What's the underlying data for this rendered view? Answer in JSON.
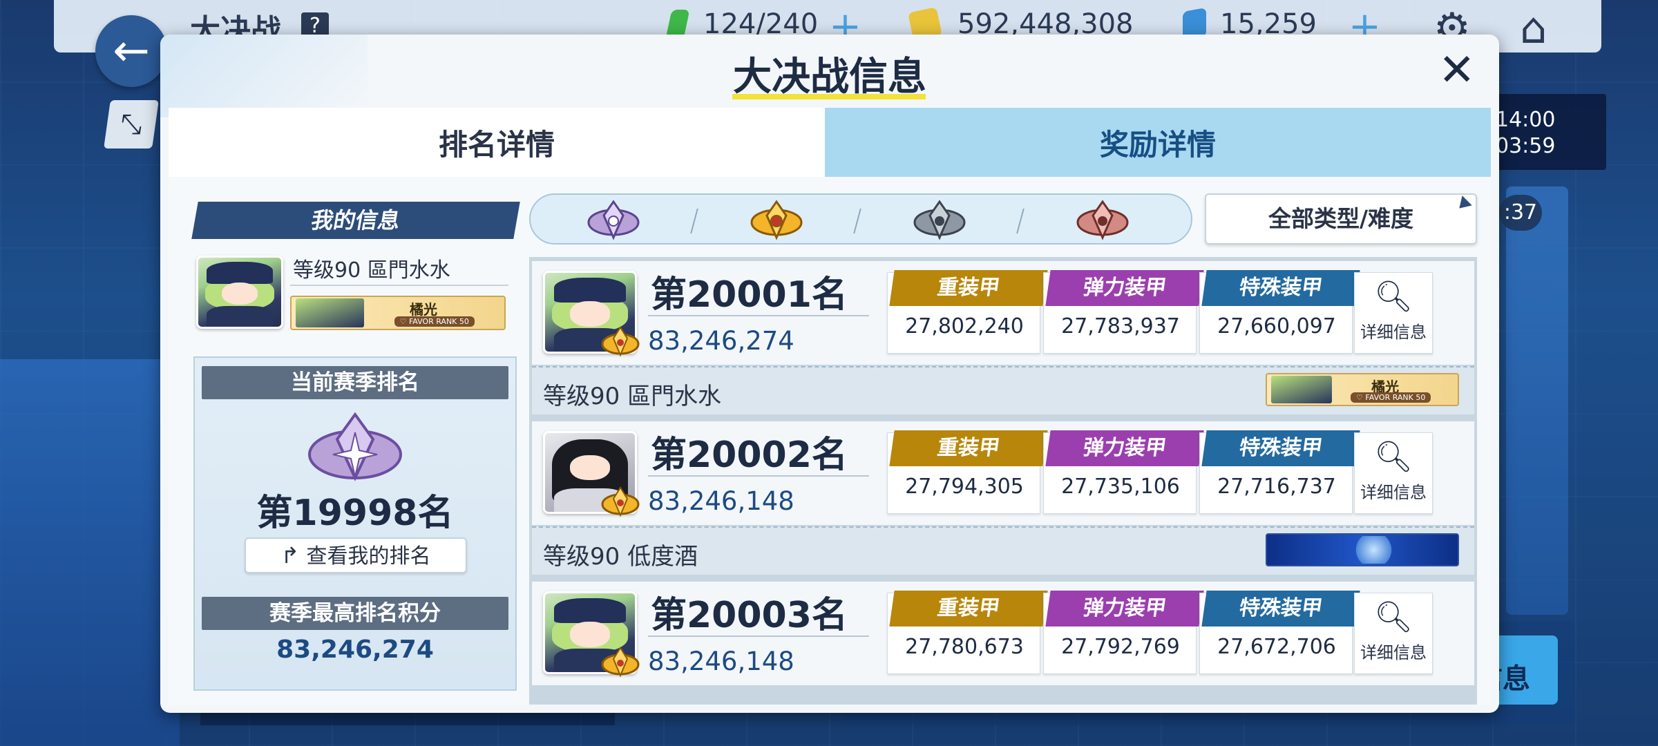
{
  "topbar": {
    "title": "大决战",
    "help_icon": "?",
    "energy": "124/240",
    "credits": "592,448,308",
    "gems": "15,259",
    "energy_color": "#3fb84a",
    "credits_color": "#e8c43a",
    "gems_color": "#3a8fd8"
  },
  "background": {
    "time_line1": "14:00",
    "time_line2": "03:59",
    "badge_text": ":37",
    "info_btn_text": "信息"
  },
  "modal": {
    "title": "大决战信息",
    "close_glyph": "✕",
    "tabs": [
      {
        "label": "排名详情",
        "active": true
      },
      {
        "label": "奖励详情",
        "active": false
      }
    ]
  },
  "my_info": {
    "header": "我的信息",
    "level_name": "等级90 區門水水",
    "namecard": {
      "name": "橘光",
      "rank": "♡ FAVOR RANK 50"
    },
    "season_rank_header": "当前赛季排名",
    "season_rank": "第19998名",
    "view_my_rank_label": "查看我的排名",
    "best_score_header": "赛季最高排名积分",
    "best_score": "83,246,274"
  },
  "filter": {
    "tiers": [
      "purple-tier",
      "gold-tier",
      "silver-tier",
      "bronze-tier"
    ],
    "difficulty_label": "全部类型/难度"
  },
  "armor_labels": {
    "heavy": "重装甲",
    "elastic": "弹力装甲",
    "special": "特殊装甲",
    "heavy_color": "#b8860b",
    "elastic_color": "#9b3fae",
    "special_color": "#236aa0"
  },
  "detail_label": "详细信息",
  "entries": [
    {
      "rank": "第20001名",
      "score": "83,246,274",
      "heavy": "27,802,240",
      "elastic": "27,783,937",
      "special": "27,660,097",
      "level_name": "等级90 區門水水",
      "namecard": {
        "name": "橘光",
        "rank": "♡ FAVOR RANK 50",
        "style": "gold"
      }
    },
    {
      "rank": "第20002名",
      "score": "83,246,148",
      "heavy": "27,794,305",
      "elastic": "27,735,106",
      "special": "27,716,737",
      "level_name": "等级90 低度酒",
      "namecard": {
        "name": "",
        "rank": "",
        "style": "blue"
      }
    },
    {
      "rank": "第20003名",
      "score": "83,246,148",
      "heavy": "27,780,673",
      "elastic": "27,792,769",
      "special": "27,672,706",
      "level_name": "",
      "namecard": {
        "name": "",
        "rank": "",
        "style": "none"
      }
    }
  ]
}
